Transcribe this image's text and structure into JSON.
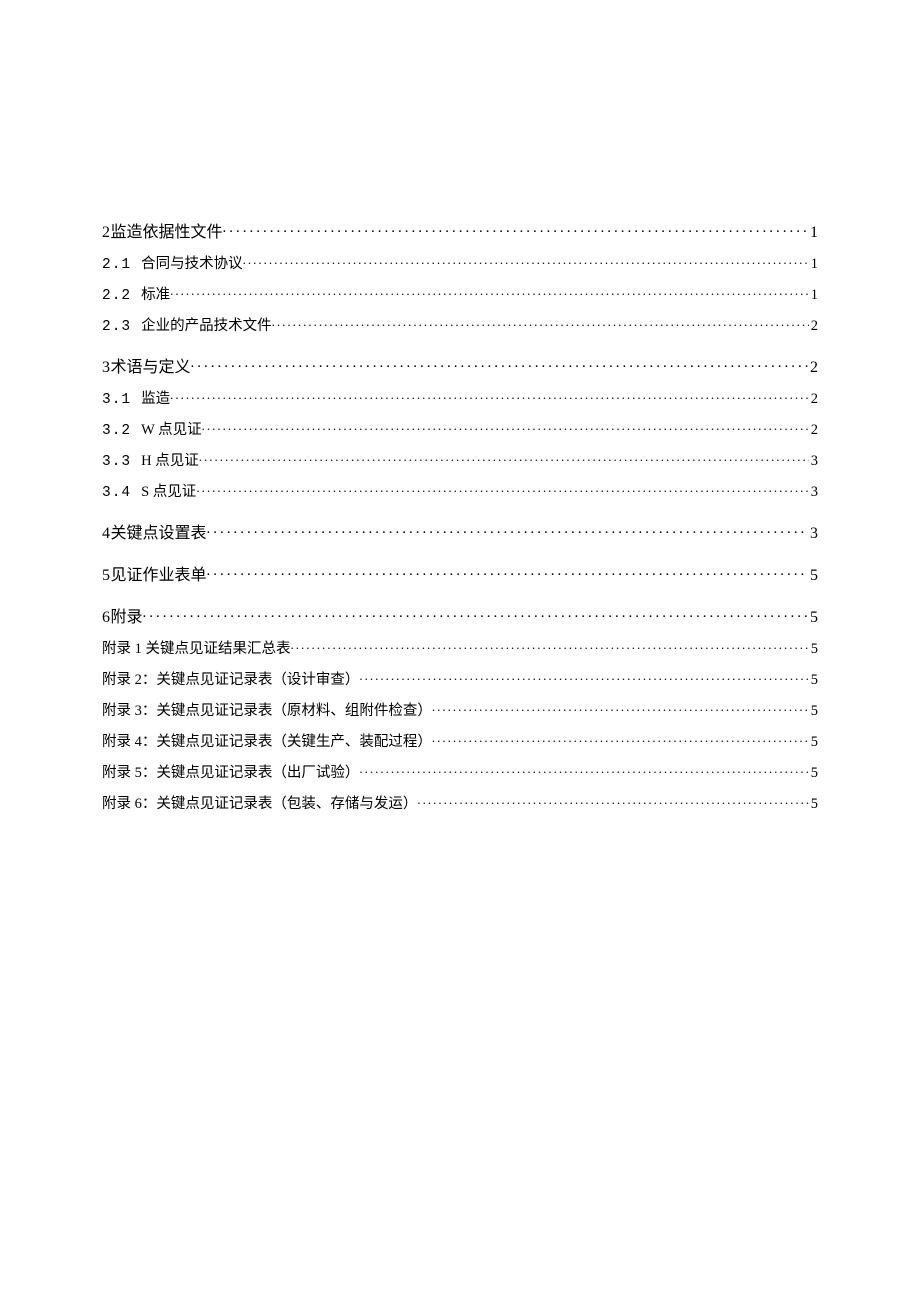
{
  "toc": [
    {
      "level": 1,
      "num": "2 ",
      "title": "监造依据性文件 ",
      "page": "1"
    },
    {
      "level": 2,
      "num": "2.1",
      "title": "合同与技术协议 ",
      "page": "1"
    },
    {
      "level": 2,
      "num": "2.2",
      "title": "标准 ",
      "page": "1"
    },
    {
      "level": 2,
      "num": "2.3",
      "title": "企业的产品技术文件 ",
      "page": "2"
    },
    {
      "level": 1,
      "num": "3 ",
      "title": "术语与定义 ",
      "page": "2"
    },
    {
      "level": 2,
      "num": "3.1",
      "title": "监造 ",
      "page": "2"
    },
    {
      "level": 2,
      "num": "3.2",
      "title": "W 点见证",
      "page": "2"
    },
    {
      "level": 2,
      "num": "3.3",
      "title": "H 点见证",
      "page": "3"
    },
    {
      "level": 2,
      "num": "3.4",
      "title": "S 点见证",
      "page": "3"
    },
    {
      "level": 1,
      "num": "4 ",
      "title": "关键点设置表 ",
      "page": "3"
    },
    {
      "level": 1,
      "num": "5 ",
      "title": "见证作业表单 ",
      "page": "5"
    },
    {
      "level": 1,
      "num": "6 ",
      "title": "附录 ",
      "page": "5"
    },
    {
      "level": 2,
      "num": "",
      "title": "附录 1 关键点见证结果汇总表 ",
      "page": "5"
    },
    {
      "level": 2,
      "num": "",
      "title": "附录 2：关键点见证记录表（设计审查） ",
      "page": "5"
    },
    {
      "level": 2,
      "num": "",
      "title": "附录 3：关键点见证记录表（原材料、组附件检查） ",
      "page": "5"
    },
    {
      "level": 2,
      "num": "",
      "title": "附录 4：关键点见证记录表（关键生产、装配过程） ",
      "page": "5"
    },
    {
      "level": 2,
      "num": "",
      "title": "附录 5：关键点见证记录表（出厂试验） ",
      "page": "5"
    },
    {
      "level": 2,
      "num": "",
      "title": "附录 6：关键点见证记录表（包装、存储与发运） ",
      "page": "5"
    }
  ]
}
